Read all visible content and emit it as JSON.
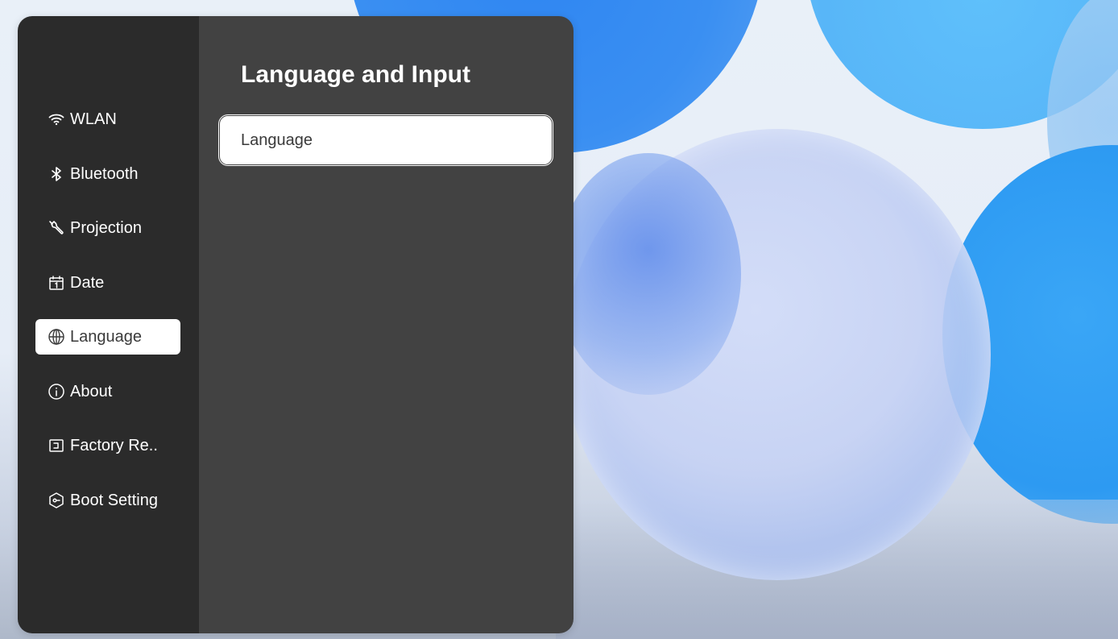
{
  "sidebar": {
    "items": [
      {
        "id": "wlan",
        "label": "WLAN",
        "icon": "wifi-icon",
        "active": false
      },
      {
        "id": "bluetooth",
        "label": "Bluetooth",
        "icon": "bluetooth-icon",
        "active": false
      },
      {
        "id": "projection",
        "label": "Projection",
        "icon": "wrench-icon",
        "active": false
      },
      {
        "id": "date",
        "label": "Date",
        "icon": "calendar-icon",
        "active": false
      },
      {
        "id": "language",
        "label": "Language",
        "icon": "globe-icon",
        "active": true
      },
      {
        "id": "about",
        "label": "About",
        "icon": "info-icon",
        "active": false
      },
      {
        "id": "factory-reset",
        "label": "Factory Re..",
        "icon": "reset-icon",
        "active": false
      },
      {
        "id": "boot-setting",
        "label": "Boot Setting",
        "icon": "boot-icon",
        "active": false
      }
    ]
  },
  "main": {
    "title": "Language and Input",
    "options": [
      {
        "label": "Language",
        "selected": true
      }
    ]
  },
  "colors": {
    "sidebar_bg": "#2b2b2b",
    "content_bg": "#424242",
    "active_item_bg": "#ffffff",
    "text_light": "#ffffff",
    "text_dark": "#3a3a3a"
  }
}
